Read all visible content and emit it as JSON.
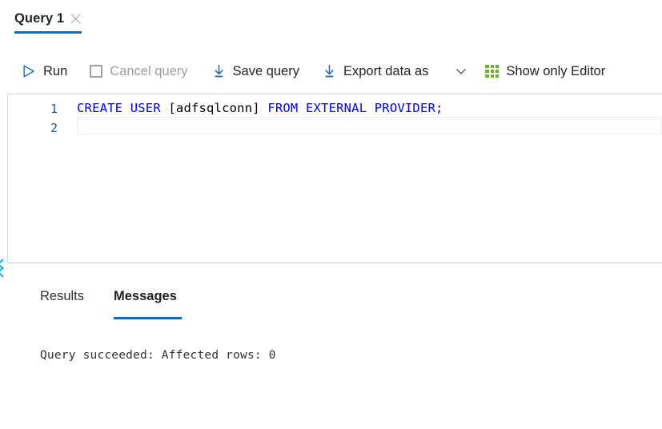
{
  "query_tab": {
    "label": "Query 1",
    "close_icon": "close-icon",
    "active": "true"
  },
  "toolbar": {
    "run": {
      "label": "Run",
      "icon": "play-icon"
    },
    "cancel": {
      "label": "Cancel query",
      "icon": "stop-square-icon",
      "disabled": "true"
    },
    "save": {
      "label": "Save query",
      "icon": "download-arrow-icon"
    },
    "export": {
      "label": "Export data as",
      "icon": "download-arrow-icon",
      "chevron": "chevron-down-icon"
    },
    "show_editor": {
      "label": "Show only Editor",
      "icon": "green-grid-icon"
    }
  },
  "editor": {
    "lines": [
      {
        "number": "1",
        "segments": [
          {
            "text": "CREATE USER ",
            "kind": "kw"
          },
          {
            "text": "[adfsqlconn]",
            "kind": "ident"
          },
          {
            "text": " FROM EXTERNAL PROVIDER;",
            "kind": "kw"
          }
        ]
      },
      {
        "number": "2",
        "segments": []
      }
    ],
    "line1_number": "1",
    "line2_number": "2",
    "line1_kw_start": "CREATE USER ",
    "line1_identifier": "[adfsqlconn]",
    "line1_kw_end": " FROM EXTERNAL PROVIDER;",
    "full_text": "CREATE USER [adfsqlconn] FROM EXTERNAL PROVIDER;"
  },
  "splitter": {
    "collapse_icon": "chevron-left-icon"
  },
  "results_tabs": {
    "results_label": "Results",
    "messages_label": "Messages",
    "active": "Messages"
  },
  "messages": {
    "text": "Query succeeded: Affected rows: 0"
  },
  "colors": {
    "accent": "#0f6cbd",
    "keyword": "#0000ff",
    "line_number": "#2b5797",
    "grid_green": "#6bb32e",
    "disabled": "#a19f9d",
    "collapse_cyan": "#00b7f0"
  }
}
